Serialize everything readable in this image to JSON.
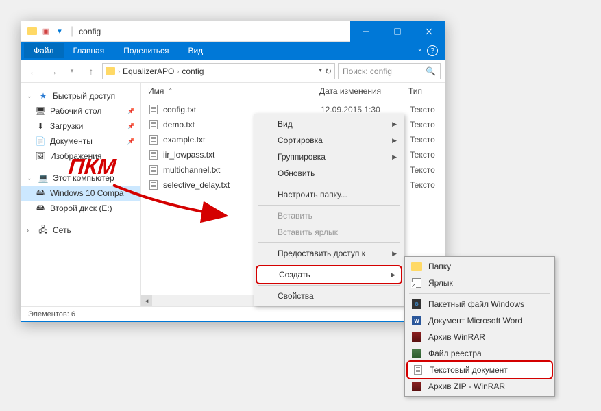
{
  "window": {
    "title": "config"
  },
  "ribbon": {
    "file": "Файл",
    "home": "Главная",
    "share": "Поделиться",
    "view": "Вид"
  },
  "address": {
    "seg1": "EqualizerAPO",
    "seg2": "config"
  },
  "search": {
    "placeholder": "Поиск: config"
  },
  "sidebar": {
    "quick": "Быстрый доступ",
    "desktop": "Рабочий стол",
    "downloads": "Загрузки",
    "documents": "Документы",
    "images": "Изображения",
    "thispc": "Этот компьютер",
    "win10": "Windows 10 Compa",
    "disk2": "Второй диск (E:)",
    "network": "Сеть"
  },
  "columns": {
    "name": "Имя",
    "date": "Дата изменения",
    "type": "Тип"
  },
  "files": [
    {
      "name": "config.txt",
      "date": "12.09.2015 1:30",
      "type": "Тексто"
    },
    {
      "name": "demo.txt",
      "date": "",
      "type": "Тексто"
    },
    {
      "name": "example.txt",
      "date": "",
      "type": "Тексто"
    },
    {
      "name": "iir_lowpass.txt",
      "date": "",
      "type": "Тексто"
    },
    {
      "name": "multichannel.txt",
      "date": "",
      "type": "Тексто"
    },
    {
      "name": "selective_delay.txt",
      "date": "",
      "type": "Тексто"
    }
  ],
  "status": {
    "count": "Элементов: 6"
  },
  "ctx1": {
    "view": "Вид",
    "sort": "Сортировка",
    "group": "Группировка",
    "refresh": "Обновить",
    "customize": "Настроить папку...",
    "paste": "Вставить",
    "pasteshortcut": "Вставить ярлык",
    "share": "Предоставить доступ к",
    "create": "Создать",
    "properties": "Свойства"
  },
  "ctx2": {
    "folder": "Папку",
    "shortcut": "Ярлык",
    "bat": "Пакетный файл Windows",
    "word": "Документ Microsoft Word",
    "rar": "Архив WinRAR",
    "reg": "Файл реестра",
    "txt": "Текстовый документ",
    "zip": "Архив ZIP - WinRAR"
  },
  "annotation": {
    "label": "ПКМ"
  }
}
